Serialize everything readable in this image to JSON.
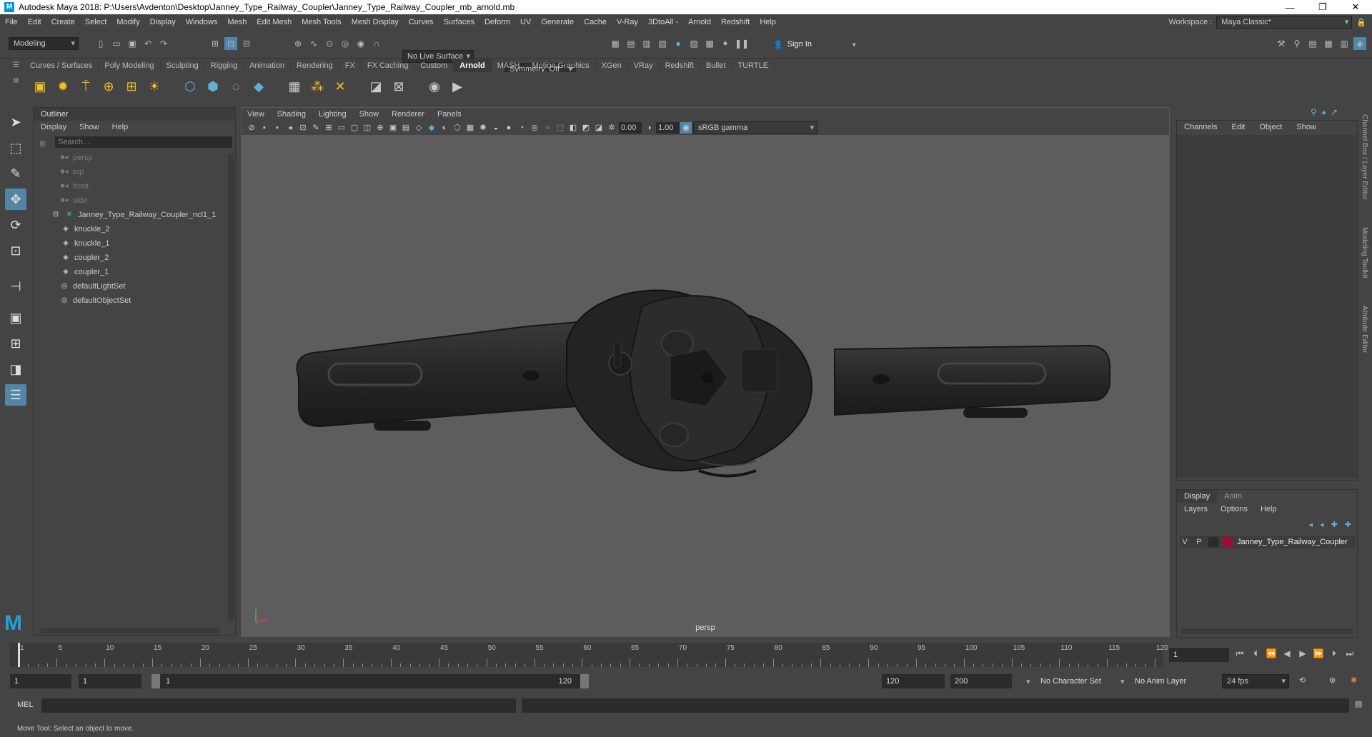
{
  "window": {
    "title": "Autodesk Maya 2018: P:\\Users\\Avdenton\\Desktop\\Janney_Type_Railway_Coupler\\Janney_Type_Railway_Coupler_mb_arnold.mb",
    "minimize": "—",
    "maximize": "❐",
    "close": "✕"
  },
  "menubar": {
    "items": [
      "File",
      "Edit",
      "Create",
      "Select",
      "Modify",
      "Display",
      "Windows",
      "Mesh",
      "Edit Mesh",
      "Mesh Tools",
      "Mesh Display",
      "Curves",
      "Surfaces",
      "Deform",
      "UV",
      "Generate",
      "Cache",
      "V-Ray",
      "3DtoAll -",
      "Arnold",
      "Redshift",
      "Help"
    ],
    "workspace_label": "Workspace :",
    "workspace_value": "Maya Classic*"
  },
  "statusline": {
    "mode": "Modeling",
    "live_surface": "No Live Surface",
    "symmetry": "Symmetry: Off",
    "sign_in": "Sign In"
  },
  "shelf": {
    "tabs": [
      "Curves / Surfaces",
      "Poly Modeling",
      "Sculpting",
      "Rigging",
      "Animation",
      "Rendering",
      "FX",
      "FX Caching",
      "Custom",
      "Arnold",
      "MASH",
      "Motion Graphics",
      "XGen",
      "VRay",
      "Redshift",
      "Bullet",
      "TURTLE"
    ],
    "active_tab": "Arnold"
  },
  "outliner": {
    "title": "Outliner",
    "menu": [
      "Display",
      "Show",
      "Help"
    ],
    "search_placeholder": "Search...",
    "items": [
      {
        "label": "persp",
        "type": "camera",
        "indent": 0,
        "dim": true
      },
      {
        "label": "top",
        "type": "camera",
        "indent": 0,
        "dim": true
      },
      {
        "label": "front",
        "type": "camera",
        "indent": 0,
        "dim": true
      },
      {
        "label": "side",
        "type": "camera",
        "indent": 0,
        "dim": true
      },
      {
        "label": "Janney_Type_Railway_Coupler_ncl1_1",
        "type": "group",
        "indent": 0,
        "dim": false
      },
      {
        "label": "knuckle_2",
        "type": "mesh",
        "indent": 1,
        "dim": false
      },
      {
        "label": "knuckle_1",
        "type": "mesh",
        "indent": 1,
        "dim": false
      },
      {
        "label": "coupler_2",
        "type": "mesh",
        "indent": 1,
        "dim": false
      },
      {
        "label": "coupler_1",
        "type": "mesh",
        "indent": 1,
        "dim": false
      },
      {
        "label": "defaultLightSet",
        "type": "set",
        "indent": 0,
        "dim": false
      },
      {
        "label": "defaultObjectSet",
        "type": "set",
        "indent": 0,
        "dim": false
      }
    ]
  },
  "viewport": {
    "menu": [
      "View",
      "Shading",
      "Lighting",
      "Show",
      "Renderer",
      "Panels"
    ],
    "exposure": "0.00",
    "gamma": "1.00",
    "color_space": "sRGB gamma",
    "camera_label": "persp"
  },
  "channelbox": {
    "menu": [
      "Channels",
      "Edit",
      "Object",
      "Show"
    ]
  },
  "layereditor": {
    "tabs": [
      "Display",
      "Anim"
    ],
    "active_tab": "Display",
    "menu": [
      "Layers",
      "Options",
      "Help"
    ],
    "layer": {
      "v": "V",
      "p": "P",
      "name": "Janney_Type_Railway_Coupler",
      "color": "#9b1030"
    }
  },
  "side_tabs": [
    "Channel Box / Layer Editor",
    "Modeling Toolkit",
    "Attribute Editor"
  ],
  "timeline": {
    "ticks": [
      1,
      5,
      10,
      15,
      20,
      25,
      30,
      35,
      40,
      45,
      50,
      55,
      60,
      65,
      70,
      75,
      80,
      85,
      90,
      95,
      100,
      105,
      110,
      115,
      120
    ],
    "current_frame": "1"
  },
  "range": {
    "start": "1",
    "playback_start": "1",
    "slider_start": "1",
    "slider_end": "120",
    "playback_end": "120",
    "end": "200",
    "character_set": "No Character Set",
    "anim_layer": "No Anim Layer",
    "fps": "24 fps"
  },
  "cmdline": {
    "label": "MEL"
  },
  "helpline": {
    "text": "Move Tool: Select an object to move."
  }
}
